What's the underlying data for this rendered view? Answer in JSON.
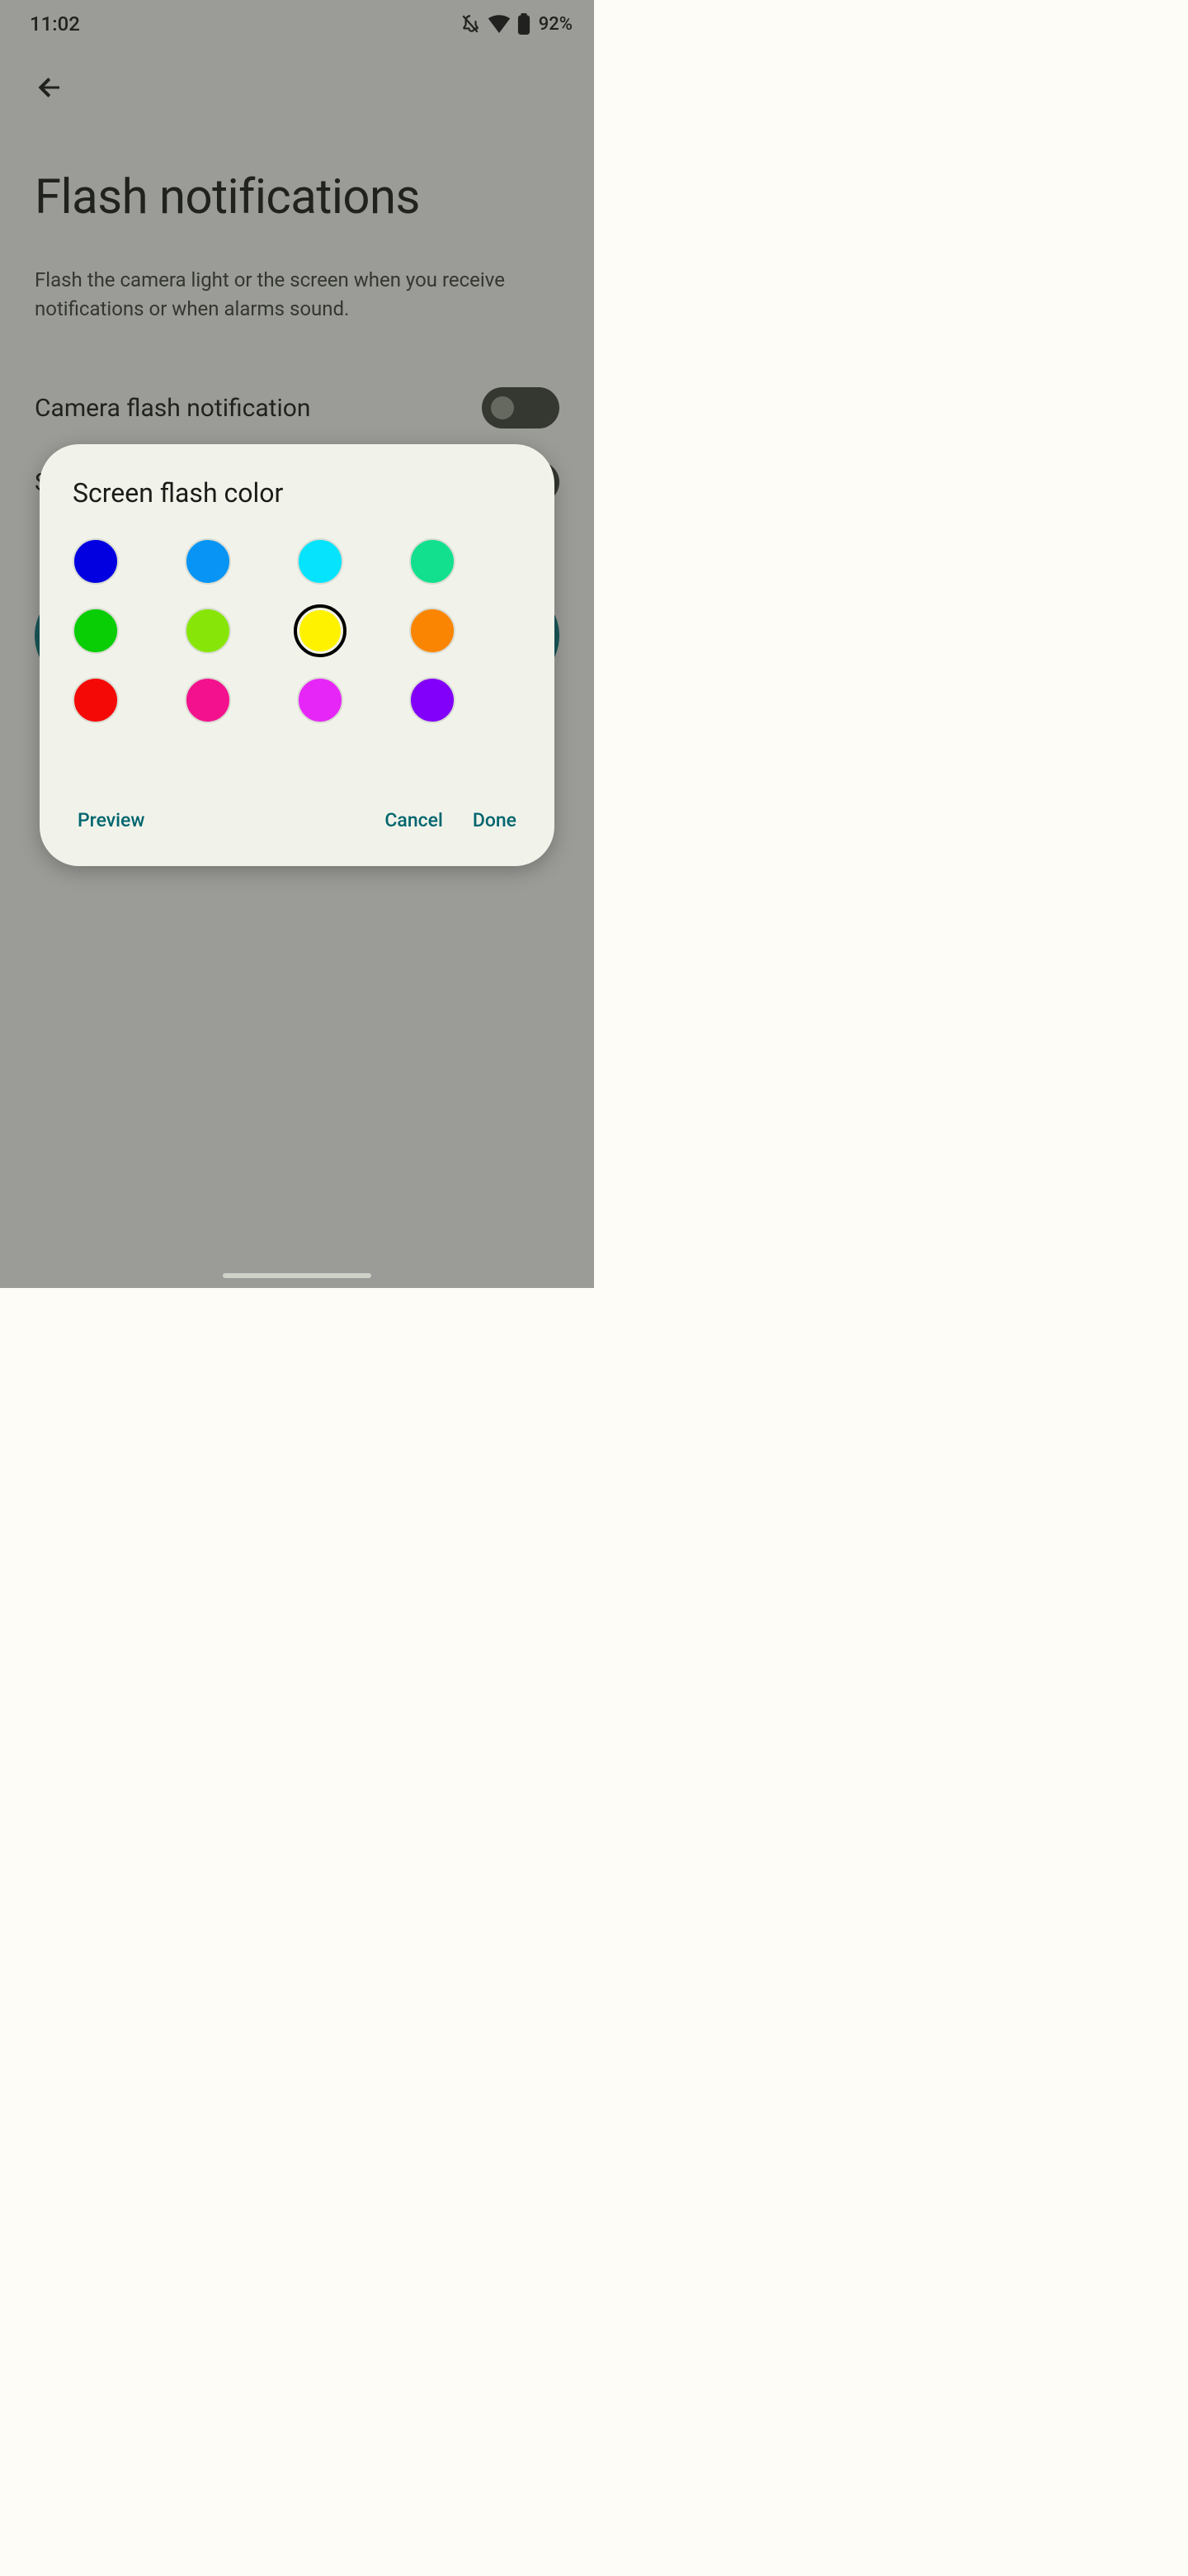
{
  "status": {
    "time": "11:02",
    "battery_pct": "92%"
  },
  "page": {
    "title": "Flash notifications",
    "description": "Flash the camera light or the screen when you receive notifications or when alarms sound.",
    "camera_flash_label": "Camera flash notification"
  },
  "dialog": {
    "title": "Screen flash color",
    "colors": [
      {
        "name": "blue",
        "hex": "#0200e1",
        "selected": false
      },
      {
        "name": "azure",
        "hex": "#0894f4",
        "selected": false
      },
      {
        "name": "cyan",
        "hex": "#05e3fd",
        "selected": false
      },
      {
        "name": "spring-green",
        "hex": "#12e08e",
        "selected": false
      },
      {
        "name": "green",
        "hex": "#09cd05",
        "selected": false
      },
      {
        "name": "lime",
        "hex": "#87e608",
        "selected": false
      },
      {
        "name": "yellow",
        "hex": "#fff200",
        "selected": true
      },
      {
        "name": "orange",
        "hex": "#fa8502",
        "selected": false
      },
      {
        "name": "red",
        "hex": "#f50907",
        "selected": false
      },
      {
        "name": "hot-pink",
        "hex": "#f3118d",
        "selected": false
      },
      {
        "name": "magenta",
        "hex": "#e626f7",
        "selected": false
      },
      {
        "name": "purple",
        "hex": "#8200f9",
        "selected": false
      }
    ],
    "preview_label": "Preview",
    "cancel_label": "Cancel",
    "done_label": "Done"
  }
}
